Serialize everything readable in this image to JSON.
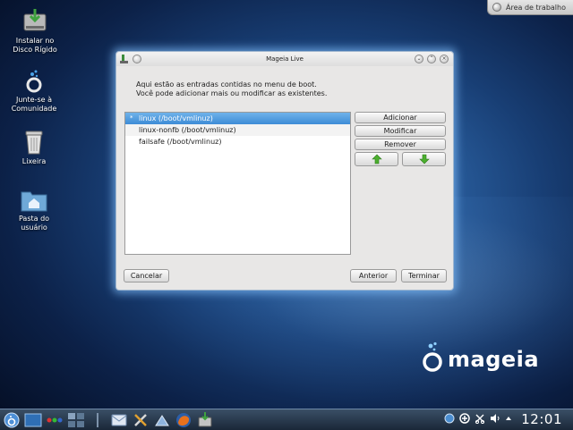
{
  "desktop": {
    "top_button_label": "Área de trabalho",
    "icons": [
      {
        "label_line1": "Instalar no",
        "label_line2": "Disco Rígido",
        "icon": "install-disk-icon"
      },
      {
        "label_line1": "Junte-se à",
        "label_line2": "Comunidade",
        "icon": "community-icon"
      },
      {
        "label_line1": "Lixeira",
        "label_line2": "",
        "icon": "trash-icon"
      },
      {
        "label_line1": "Pasta do",
        "label_line2": "usuário",
        "icon": "home-folder-icon"
      }
    ]
  },
  "window": {
    "title": "Mageia Live",
    "intro_line1": "Aqui estão as entradas contidas no menu de boot.",
    "intro_line2": "Você pode adicionar mais ou modificar as existentes.",
    "entries": [
      {
        "label": "linux (/boot/vmlinuz)",
        "default_marker": "*"
      },
      {
        "label": "linux-nonfb (/boot/vmlinuz)",
        "default_marker": ""
      },
      {
        "label": "failsafe (/boot/vmlinuz)",
        "default_marker": ""
      }
    ],
    "buttons": {
      "add": "Adicionar",
      "modify": "Modificar",
      "remove": "Remover",
      "cancel": "Cancelar",
      "previous": "Anterior",
      "finish": "Terminar"
    }
  },
  "logo_text": "mageia",
  "taskbar": {
    "clock": "12:01"
  },
  "colors": {
    "selection": "#3d8bd6",
    "arrow_green": "#4caf2e",
    "window_glow": "#78b4f0"
  }
}
